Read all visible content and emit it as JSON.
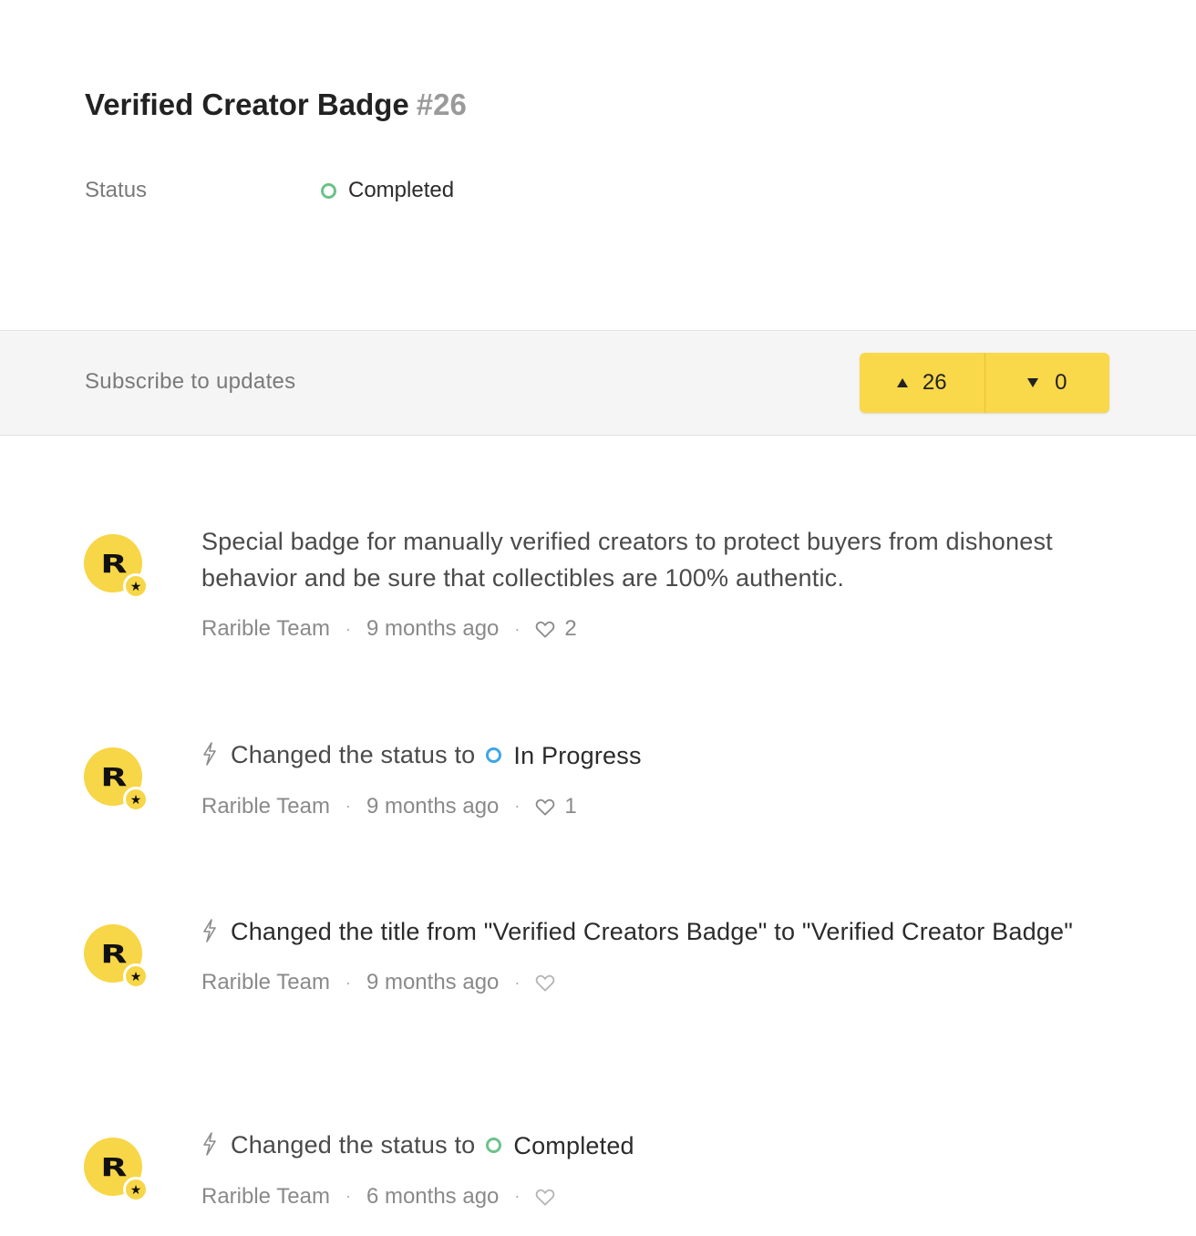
{
  "post": {
    "title": "Verified Creator Badge",
    "number": "#26",
    "status_label": "Status",
    "status_value": "Completed",
    "status_color": "#6cc28a"
  },
  "subscribe": {
    "label": "Subscribe to updates",
    "upvotes": "26",
    "downvotes": "0",
    "accent": "#f9d849"
  },
  "activity": [
    {
      "type": "comment",
      "text": "Special badge for manually verified creators to protect buyers from dishonest behavior and be sure that collectibles are 100% authentic.",
      "author": "Rarible Team",
      "time": "9 months ago",
      "likes": "2"
    },
    {
      "type": "status_change",
      "prefix": "Changed the status to",
      "status": "In Progress",
      "status_color": "#3ea6e8",
      "author": "Rarible Team",
      "time": "9 months ago",
      "likes": "1"
    },
    {
      "type": "title_change",
      "text": "Changed the title from \"Verified Creators Badge\" to \"Verified Creator Badge\"",
      "author": "Rarible Team",
      "time": "9 months ago",
      "likes": ""
    },
    {
      "type": "status_change",
      "prefix": "Changed the status to",
      "status": "Completed",
      "status_color": "#6cc28a",
      "author": "Rarible Team",
      "time": "6 months ago",
      "likes": ""
    }
  ],
  "icons": {
    "avatar": "rarible-logo-icon",
    "badge": "star-badge-icon",
    "activity": "lightning-bolt-icon",
    "like": "heart-icon",
    "upvote": "triangle-up-icon",
    "downvote": "triangle-down-icon"
  },
  "avatar_letter": "R",
  "badge_glyph": "★"
}
